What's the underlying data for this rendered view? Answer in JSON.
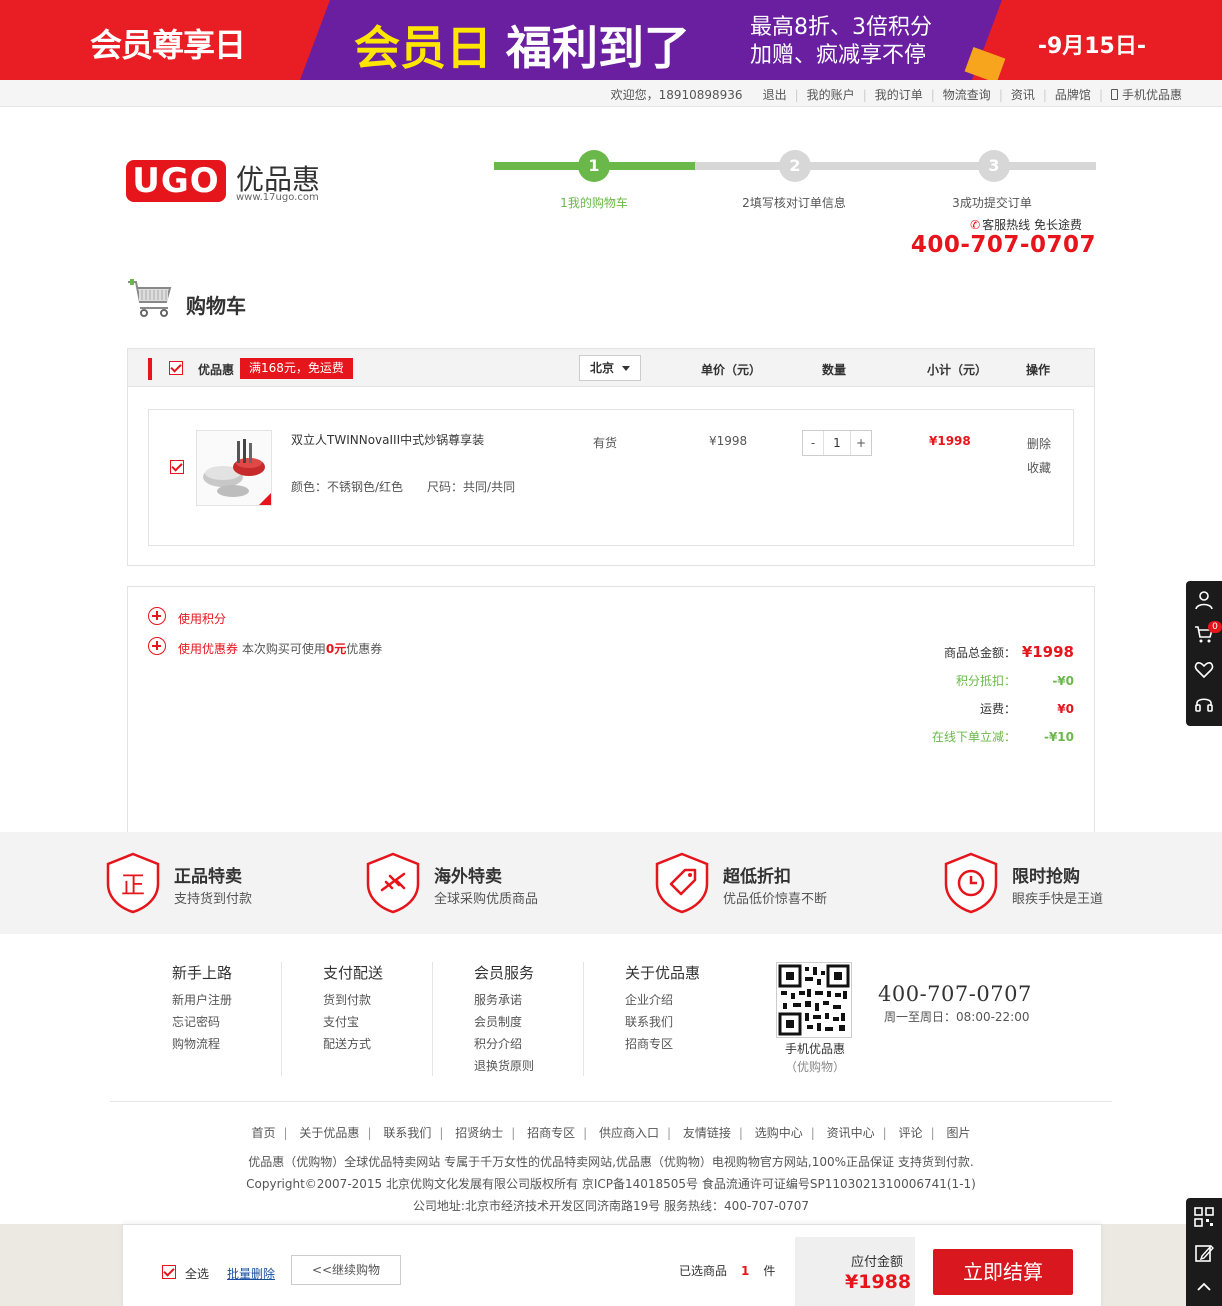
{
  "banner": {
    "left_text": "会员尊享日",
    "title_yellow": "会员日",
    "title_white": "福利到了",
    "sub_line1": "最高8折、3倍积分",
    "sub_line2": "加赠、疯减享不停",
    "date": "-9月15日-"
  },
  "topbar": {
    "welcome": "欢迎您，18910898936",
    "logout": "退出",
    "account": "我的账户",
    "orders": "我的订单",
    "logistics": "物流查询",
    "news": "资讯",
    "brands": "品牌馆",
    "mobile": "手机优品惠"
  },
  "logo": {
    "mark": "UGO",
    "name": "优品惠",
    "url": "www.17ugo.com"
  },
  "steps": [
    {
      "num": "1",
      "label": "1我的购物车"
    },
    {
      "num": "2",
      "label": "2填写核对订单信息"
    },
    {
      "num": "3",
      "label": "3成功提交订单"
    }
  ],
  "hotline": {
    "label": "客服热线  免长途费",
    "number": "400-707-0707"
  },
  "cart_title": "购物车",
  "cart_head": {
    "shop": "优品惠",
    "promo": "满168元，免运费",
    "region": "北京",
    "col_price": "单价（元）",
    "col_qty": "数量",
    "col_subtotal": "小计（元）",
    "col_ops": "操作"
  },
  "item": {
    "name": "双立人TWINNovaIII中式炒锅尊享装",
    "color": "颜色：不锈钢色/红色",
    "size": "尺码：共同/共同",
    "stock": "有货",
    "unit_price": "¥1998",
    "qty": "1",
    "qty_minus": "-",
    "qty_plus": "+",
    "subtotal": "¥1998",
    "op_delete": "删除",
    "op_fav": "收藏"
  },
  "summary": {
    "use_points": "使用积分",
    "use_coupon": "使用优惠券",
    "coupon_note_pre": "本次购买可使用",
    "coupon_amount": "0元",
    "coupon_note_post": "优惠券",
    "total_label": "商品总金额：",
    "total_value": "¥1998",
    "points_label": "积分抵扣：",
    "points_value": "-¥0",
    "shipping_label": "运费：",
    "shipping_value": "¥0",
    "online_label": "在线下单立减：",
    "online_value": "-¥10"
  },
  "features": [
    {
      "title": "正品特卖",
      "sub": "支持货到付款",
      "icon": "正"
    },
    {
      "title": "海外特卖",
      "sub": "全球采购优质商品",
      "icon": "plane"
    },
    {
      "title": "超低折扣",
      "sub": "优品低价惊喜不断",
      "icon": "tag"
    },
    {
      "title": "限时抢购",
      "sub": "眼疾手快是王道",
      "icon": "clock"
    }
  ],
  "footer_cols": [
    {
      "title": "新手上路",
      "links": [
        "新用户注册",
        "忘记密码",
        "购物流程"
      ]
    },
    {
      "title": "支付配送",
      "links": [
        "货到付款",
        "支付宝",
        "配送方式"
      ]
    },
    {
      "title": "会员服务",
      "links": [
        "服务承诺",
        "会员制度",
        "积分介绍",
        "退换货原则"
      ]
    },
    {
      "title": "关于优品惠",
      "links": [
        "企业介绍",
        "联系我们",
        "招商专区"
      ]
    }
  ],
  "footer_qr": {
    "label": "手机优品惠",
    "sub": "（优购物）"
  },
  "footer_tel": {
    "number": "400-707-0707",
    "hours": "周一至周日：08:00-22:00"
  },
  "footer_links": [
    "首页",
    "关于优品惠",
    "联系我们",
    "招贤纳士",
    "招商专区",
    "供应商入口",
    "友情链接",
    "选购中心",
    "资讯中心",
    "评论",
    "图片"
  ],
  "footer_copy": {
    "line1": "优品惠（优购物）全球优品特卖网站 专属于千万女性的优品特卖网站,优品惠（优购物）电视购物官方网站,100%正品保证 支持货到付款.",
    "line2": "Copyright©2007-2015 北京优购文化发展有限公司版权所有 京ICP备14018505号 食品流通许可证编号SP1103021310006741(1-1)",
    "line3": "公司地址:北京市经济技术开发区同济南路19号 服务热线：400-707-0707"
  },
  "bottom_bar": {
    "select_all": "全选",
    "batch_delete": "批量删除",
    "continue": "<<继续购物",
    "selected_pre": "已选商品",
    "selected_count": "1",
    "selected_post": "件",
    "pay_label": "应付金额",
    "pay_value": "¥1988",
    "checkout": "立即结算"
  },
  "side_toolbar": {
    "cart_badge": "0"
  },
  "colors": {
    "brand_red": "#e5151b",
    "step_green": "#6ab84a",
    "banner_purple": "#6a1fa0"
  }
}
